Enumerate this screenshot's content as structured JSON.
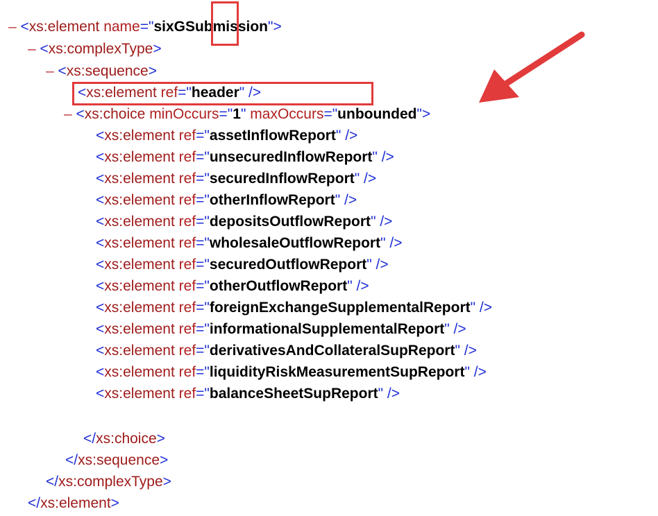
{
  "xml": {
    "twisty": "–",
    "root": {
      "open": "<",
      "tag": "xs:element",
      "attr": "name",
      "eq": "=\"",
      "value": "sixGSubmission",
      "close": "\">"
    },
    "complex": {
      "open": "<",
      "tag": "xs:complexType",
      "close": ">"
    },
    "sequence": {
      "open": "<",
      "tag": "xs:sequence",
      "close": ">"
    },
    "header": {
      "open": "<",
      "tag": "xs:element",
      "attr": "ref",
      "eq": "=\"",
      "value": "header",
      "close": "\" />"
    },
    "choice": {
      "open": "<",
      "tag": "xs:choice",
      "attr1": "minOccurs",
      "eq": "=\"",
      "val1": "1",
      "q": "\"",
      "attr2": "maxOccurs",
      "val2": "unbounded",
      "close": "\">"
    },
    "refs": [
      {
        "open": "<",
        "tag": "xs:element",
        "attr": "ref",
        "eq": "=\"",
        "value": "assetInflowReport",
        "close": "\" />"
      },
      {
        "open": "<",
        "tag": "xs:element",
        "attr": "ref",
        "eq": "=\"",
        "value": "unsecuredInflowReport",
        "close": "\" />"
      },
      {
        "open": "<",
        "tag": "xs:element",
        "attr": "ref",
        "eq": "=\"",
        "value": "securedInflowReport",
        "close": "\" />"
      },
      {
        "open": "<",
        "tag": "xs:element",
        "attr": "ref",
        "eq": "=\"",
        "value": "otherInflowReport",
        "close": "\" />"
      },
      {
        "open": "<",
        "tag": "xs:element",
        "attr": "ref",
        "eq": "=\"",
        "value": "depositsOutflowReport",
        "close": "\" />"
      },
      {
        "open": "<",
        "tag": "xs:element",
        "attr": "ref",
        "eq": "=\"",
        "value": "wholesaleOutflowReport",
        "close": "\" />"
      },
      {
        "open": "<",
        "tag": "xs:element",
        "attr": "ref",
        "eq": "=\"",
        "value": "securedOutflowReport",
        "close": "\" />"
      },
      {
        "open": "<",
        "tag": "xs:element",
        "attr": "ref",
        "eq": "=\"",
        "value": "otherOutflowReport",
        "close": "\" />"
      },
      {
        "open": "<",
        "tag": "xs:element",
        "attr": "ref",
        "eq": "=\"",
        "value": "foreignExchangeSupplementalReport",
        "close": "\" />"
      },
      {
        "open": "<",
        "tag": "xs:element",
        "attr": "ref",
        "eq": "=\"",
        "value": "informationalSupplementalReport",
        "close": "\" />"
      },
      {
        "open": "<",
        "tag": "xs:element",
        "attr": "ref",
        "eq": "=\"",
        "value": "derivativesAndCollateralSupReport",
        "close": "\" />"
      },
      {
        "open": "<",
        "tag": "xs:element",
        "attr": "ref",
        "eq": "=\"",
        "value": "liquidityRiskMeasurementSupReport",
        "close": "\" />"
      },
      {
        "open": "<",
        "tag": "xs:element",
        "attr": "ref",
        "eq": "=\"",
        "value": "balanceSheetSupReport",
        "close": "\" />"
      }
    ],
    "choice_end": {
      "open": "</",
      "tag": "xs:choice",
      "close": ">"
    },
    "sequence_end": {
      "open": "</",
      "tag": "xs:sequence",
      "close": ">"
    },
    "complex_end": {
      "open": "</",
      "tag": "xs:complexType",
      "close": ">"
    },
    "root_end": {
      "open": "</",
      "tag": "xs:element",
      "close": ">"
    }
  },
  "annotation": {
    "box_color": "#e23b3b",
    "arrow_color": "#e23b3b"
  }
}
